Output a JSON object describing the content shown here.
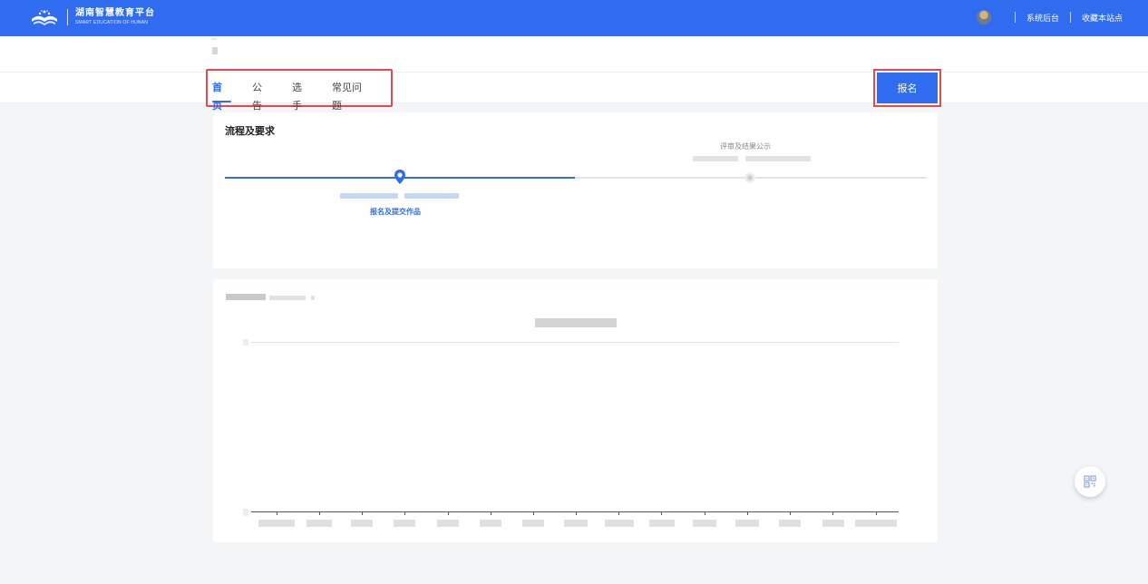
{
  "header": {
    "logo_cn": "湖南智慧教育平台",
    "logo_en": "SMART EDUCATION OF HUNAN",
    "links": [
      "系统后台",
      "收藏本站点"
    ]
  },
  "nav": {
    "tabs": [
      "首页",
      "公告",
      "选手",
      "常见问题"
    ],
    "active_tab": "首页",
    "signup_label": "报名"
  },
  "process": {
    "title": "流程及要求",
    "steps": [
      {
        "label": "报名及提交作品",
        "status": "current"
      },
      {
        "label": "评审及结果公示",
        "status": "upcoming"
      }
    ]
  },
  "colors": {
    "brand": "#2f6cf0",
    "highlight": "#e4494f"
  }
}
